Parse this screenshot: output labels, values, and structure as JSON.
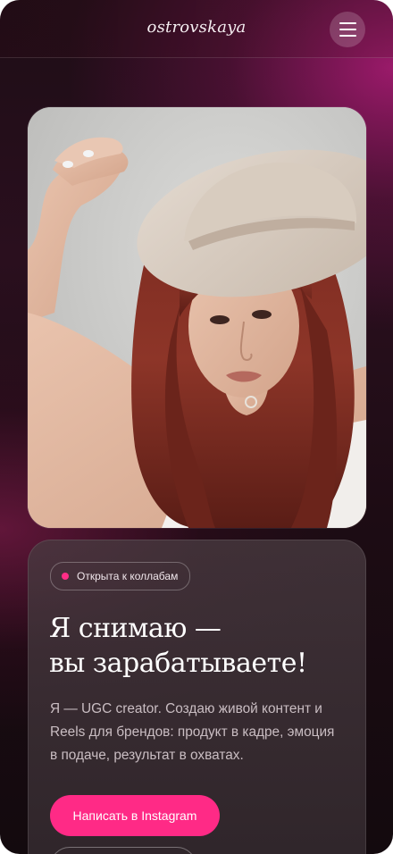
{
  "header": {
    "logo": "ostrovskaya",
    "menu_icon": "hamburger-menu-icon"
  },
  "hero_photo": {
    "subject": "portrait-photo"
  },
  "intro_card": {
    "badge": {
      "status_color": "#ff2d86",
      "label": "Открыта к коллабам"
    },
    "headline": {
      "line1": "Я снимаю —",
      "line2": "вы зарабатываете!"
    },
    "description": "Я — UGC creator. Создаю живой контент и Reels для брендов: продукт в кадре, эмоция в подаче, результат в охватах.",
    "cta_label": "Написать в Instagram",
    "cta_color": "#ff2a86"
  }
}
